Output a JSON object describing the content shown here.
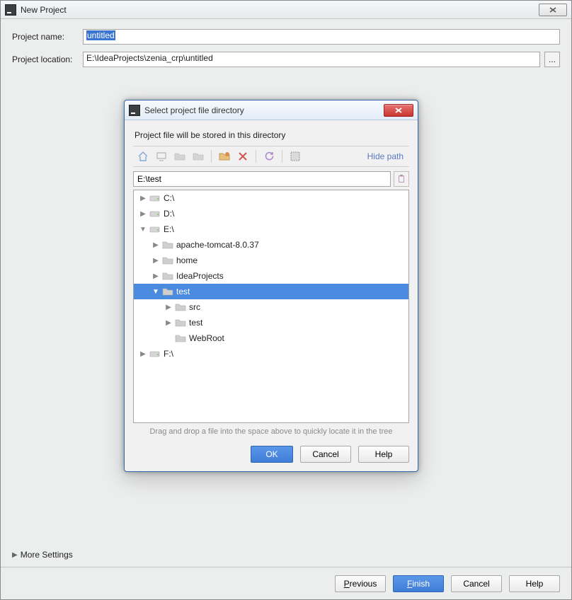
{
  "outer": {
    "title": "New Project",
    "labels": {
      "name": "Project name:",
      "location": "Project location:"
    },
    "fields": {
      "name": "untitled",
      "location": "E:\\IdeaProjects\\zenia_crp\\untitled"
    },
    "browse_ellipsis": "...",
    "more_settings": "More Settings",
    "buttons": {
      "previous_u": "P",
      "previous_rest": "revious",
      "finish_u": "F",
      "finish_rest": "inish",
      "cancel": "Cancel",
      "help": "Help"
    }
  },
  "modal": {
    "title": "Select project file directory",
    "hint": "Project file will be stored in this directory",
    "hide_path": "Hide path",
    "path_value": "E:\\test",
    "drag_hint": "Drag and drop a file into the space above to quickly locate it in the tree",
    "buttons": {
      "ok": "OK",
      "cancel": "Cancel",
      "help": "Help"
    },
    "tree": [
      {
        "depth": 0,
        "expand": "closed",
        "icon": "drive",
        "label": "C:\\"
      },
      {
        "depth": 0,
        "expand": "closed",
        "icon": "drive",
        "label": "D:\\"
      },
      {
        "depth": 0,
        "expand": "open",
        "icon": "drive",
        "label": "E:\\"
      },
      {
        "depth": 1,
        "expand": "closed",
        "icon": "folder",
        "label": "apache-tomcat-8.0.37"
      },
      {
        "depth": 1,
        "expand": "closed",
        "icon": "folder",
        "label": "home"
      },
      {
        "depth": 1,
        "expand": "closed",
        "icon": "folder",
        "label": "IdeaProjects"
      },
      {
        "depth": 1,
        "expand": "open",
        "icon": "folder",
        "label": "test",
        "selected": true
      },
      {
        "depth": 2,
        "expand": "closed",
        "icon": "folder",
        "label": "src"
      },
      {
        "depth": 2,
        "expand": "closed",
        "icon": "folder",
        "label": "test"
      },
      {
        "depth": 2,
        "expand": "none",
        "icon": "folder",
        "label": "WebRoot"
      },
      {
        "depth": 0,
        "expand": "closed",
        "icon": "drive",
        "label": "F:\\"
      }
    ]
  }
}
